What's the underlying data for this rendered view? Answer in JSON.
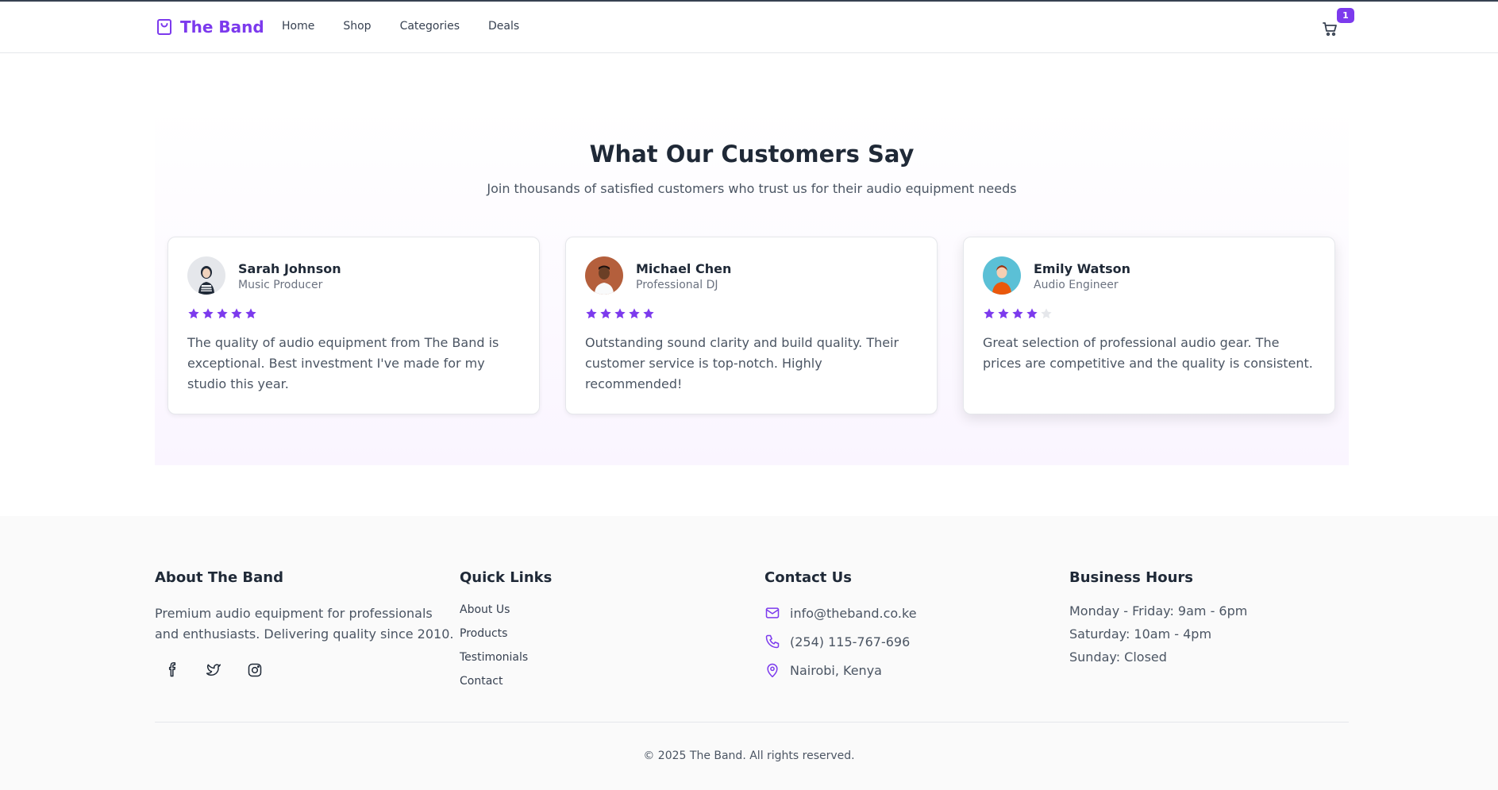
{
  "header": {
    "brand": "The Band",
    "nav": [
      "Home",
      "Shop",
      "Categories",
      "Deals"
    ],
    "cart_count": "1"
  },
  "testimonials": {
    "title": "What Our Customers Say",
    "subtitle": "Join thousands of satisfied customers who trust us for their audio equipment needs",
    "items": [
      {
        "name": "Sarah Johnson",
        "role": "Music Producer",
        "rating": 5,
        "text": "The quality of audio equipment from The Band is exceptional. Best investment I've made for my studio this year."
      },
      {
        "name": "Michael Chen",
        "role": "Professional DJ",
        "rating": 5,
        "text": "Outstanding sound clarity and build quality. Their customer service is top-notch. Highly recommended!"
      },
      {
        "name": "Emily Watson",
        "role": "Audio Engineer",
        "rating": 4,
        "text": "Great selection of professional audio gear. The prices are competitive and the quality is consistent."
      }
    ]
  },
  "footer": {
    "about": {
      "title": "About The Band",
      "text": "Premium audio equipment for professionals and enthusiasts. Delivering quality since 2010."
    },
    "quick_links": {
      "title": "Quick Links",
      "items": [
        "About Us",
        "Products",
        "Testimonials",
        "Contact"
      ]
    },
    "contact": {
      "title": "Contact Us",
      "email": "info@theband.co.ke",
      "phone": "(254) 115-767-696",
      "location": "Nairobi, Kenya"
    },
    "hours": {
      "title": "Business Hours",
      "items": [
        "Monday - Friday: 9am - 6pm",
        "Saturday: 10am - 4pm",
        "Sunday: Closed"
      ]
    },
    "copyright": "© 2025 The Band. All rights reserved."
  },
  "colors": {
    "accent": "#7c3aed",
    "star_empty": "#e5e7eb"
  }
}
